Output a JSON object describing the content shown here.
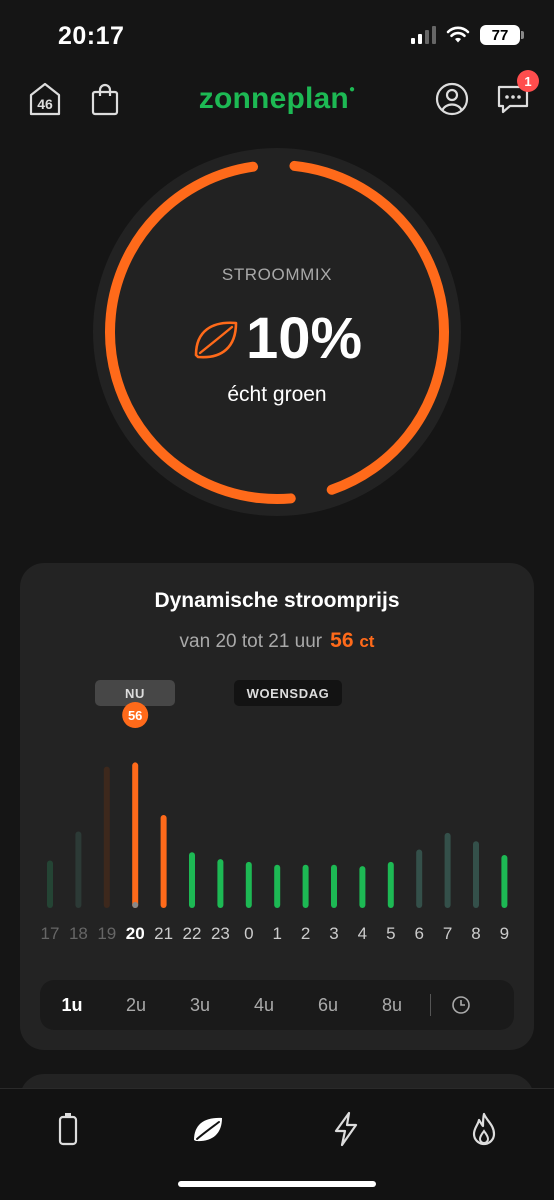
{
  "status_bar": {
    "time": "20:17",
    "battery": "77"
  },
  "header": {
    "logo": "zonneplan",
    "home_number": "46",
    "messages_badge": "1"
  },
  "stroommix": {
    "label": "STROOMMIX",
    "value": "10%",
    "subtitle": "écht groen",
    "progress_percent": 10
  },
  "price_card": {
    "title": "Dynamische stroomprijs",
    "subtitle": "van 20 tot 21 uur",
    "price": "56",
    "price_unit": "ct",
    "tag_now": "NU",
    "tag_day": "WOENSDAG",
    "current_marker": "56"
  },
  "chart_data": {
    "type": "bar",
    "categories": [
      "17",
      "18",
      "19",
      "20",
      "21",
      "22",
      "23",
      "0",
      "1",
      "2",
      "3",
      "4",
      "5",
      "6",
      "7",
      "8",
      "9"
    ],
    "values": [
      30,
      51,
      98,
      101,
      63,
      36,
      31,
      29,
      27,
      27,
      27,
      26,
      29,
      38,
      50,
      44,
      34
    ],
    "current_index": 3,
    "ylim": [
      0,
      110
    ]
  },
  "tabs": [
    "1u",
    "2u",
    "3u",
    "4u",
    "6u",
    "8u"
  ],
  "active_tab": "1u",
  "colors": {
    "accent_orange": "#ff6a1a",
    "green": "#1db954",
    "past_dark": "#244434"
  }
}
